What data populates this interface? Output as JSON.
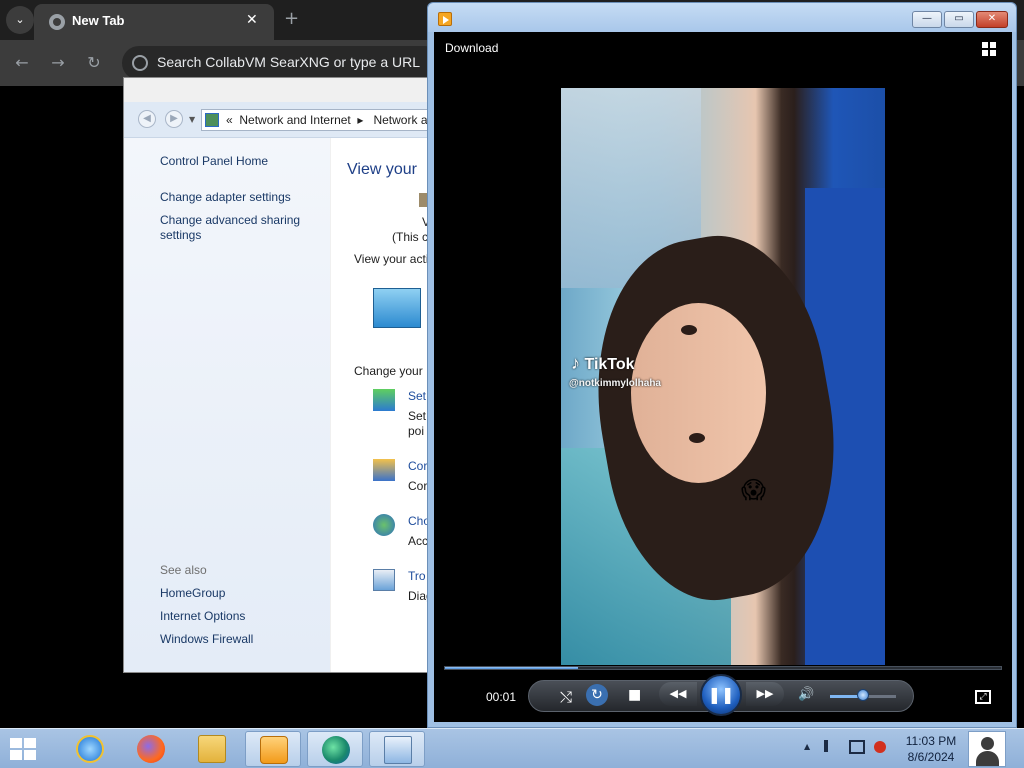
{
  "browser": {
    "tab_title": "New Tab",
    "omnibox_placeholder": "Search CollabVM SearXNG or type a URL",
    "tab_close": "✕",
    "new_tab": "+",
    "tab_menu": "⌄"
  },
  "control_panel": {
    "breadcrumb_prefix": "«",
    "breadcrumb": [
      "Network and Internet",
      "Network a"
    ],
    "sidebar": {
      "home": "Control Panel Home",
      "links": [
        "Change adapter settings",
        "Change advanced sharing settings"
      ],
      "see_also_label": "See also",
      "see_also": [
        "HomeGroup",
        "Internet Options",
        "Windows Firewall"
      ]
    },
    "main": {
      "title": "View your",
      "line_v": "V",
      "line_this": "(This c",
      "view_active": "View your acti",
      "change_your": "Change your",
      "items": [
        {
          "link": "Set",
          "desc1": "Set",
          "desc2": "poi",
          "icon": "new-connection-icon"
        },
        {
          "link": "Cor",
          "desc1": "Cor",
          "desc2": "",
          "icon": "homegroup-icon"
        },
        {
          "link": "Cho",
          "desc1": "Acc",
          "desc2": "",
          "icon": "sharing-icon"
        },
        {
          "link": "Tro",
          "desc1": "Diag",
          "desc2": "",
          "icon": "troubleshoot-icon"
        }
      ]
    }
  },
  "media_player": {
    "download_label": "Download",
    "time": "00:01",
    "progress_fraction": 0.24,
    "volume_fraction": 0.5,
    "video": {
      "watermark": "TikTok",
      "handle": "@notkimmylolhaha",
      "emoji": "😱"
    },
    "controls": {
      "shuffle": "⤭",
      "repeat": "↻",
      "stop": "■",
      "prev": "◀◀",
      "pause": "❚❚",
      "next": "▶▶",
      "mute": "🔊",
      "fullscreen": "⤢"
    },
    "window_buttons": {
      "minimize": "—",
      "maximize": "▭",
      "close": "✕"
    }
  },
  "taskbar": {
    "time": "11:03 PM",
    "date": "8/6/2024",
    "apps": [
      "internet-explorer-icon",
      "firefox-icon",
      "file-explorer-icon",
      "windows-media-player-icon",
      "edge-icon",
      "control-panel-icon"
    ],
    "tray_chevron": "▲"
  },
  "colors": {
    "cp_link": "#1a3966",
    "cp_title": "#1e3f87",
    "taskbar": "#a9c4e4",
    "accent_blue": "#1f5fbf"
  }
}
